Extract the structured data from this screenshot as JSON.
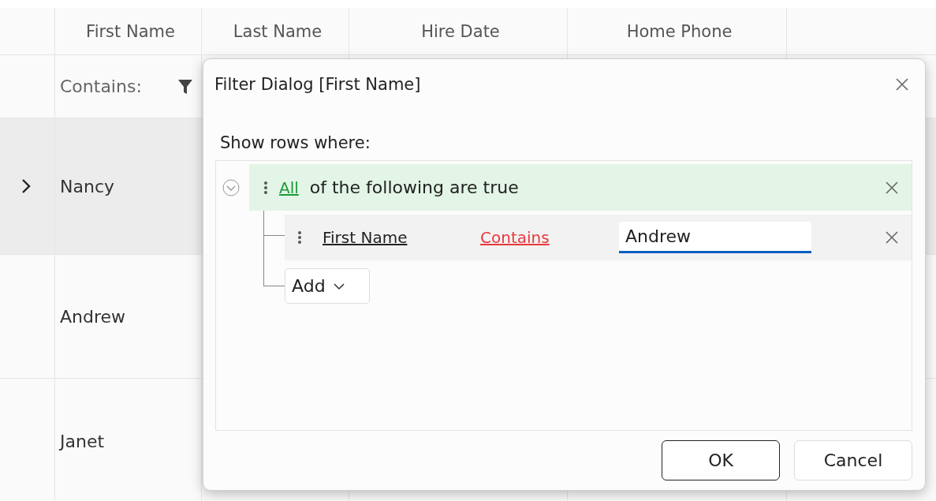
{
  "grid": {
    "columns": [
      "First Name",
      "Last Name",
      "Hire Date",
      "Home Phone"
    ],
    "filter_row": {
      "operator": "Contains:"
    },
    "rows": [
      {
        "first_name": "Nancy",
        "selected": true
      },
      {
        "first_name": "Andrew",
        "selected": false
      },
      {
        "first_name": "Janet",
        "selected": false
      }
    ]
  },
  "dialog": {
    "title": "Filter Dialog [First Name]",
    "prompt": "Show rows where:",
    "group": {
      "expanded": true,
      "quantifier": "All",
      "text": "of the following are true",
      "conditions": [
        {
          "field": "First Name",
          "operator": "Contains",
          "value": "Andrew"
        }
      ],
      "add_label": "Add"
    },
    "buttons": [
      {
        "label": "OK",
        "default": true
      },
      {
        "label": "Cancel",
        "default": false
      }
    ]
  }
}
